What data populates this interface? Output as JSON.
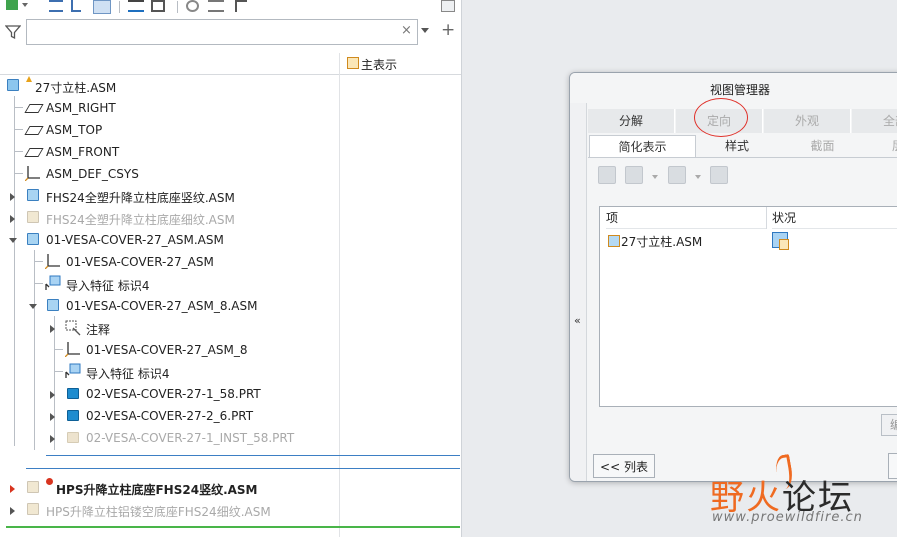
{
  "left_panel": {
    "search": {
      "value": "",
      "placeholder": ""
    },
    "clear_glyph": "×",
    "add_glyph": "+",
    "column_header": "主表示",
    "tree": [
      {
        "label": "27寸立柱.ASM",
        "icon": "assembly-icon"
      },
      {
        "label": "ASM_RIGHT",
        "icon": "datum-plane-icon"
      },
      {
        "label": "ASM_TOP",
        "icon": "datum-plane-icon"
      },
      {
        "label": "ASM_FRONT",
        "icon": "datum-plane-icon"
      },
      {
        "label": "ASM_DEF_CSYS",
        "icon": "csys-icon"
      },
      {
        "label": "FHS24全塑升降立柱底座竖纹.ASM",
        "icon": "assembly-icon"
      },
      {
        "label": "FHS24全塑升降立柱底座细纹.ASM",
        "icon": "assembly-icon",
        "state": "excluded"
      },
      {
        "label": "01-VESA-COVER-27_ASM.ASM",
        "icon": "assembly-icon"
      },
      {
        "label": "01-VESA-COVER-27_ASM",
        "icon": "csys-icon"
      },
      {
        "label": "导入特征 标识4",
        "icon": "import-feature-icon"
      },
      {
        "label": "01-VESA-COVER-27_ASM_8.ASM",
        "icon": "assembly-icon"
      },
      {
        "label": "注释",
        "icon": "annotation-icon"
      },
      {
        "label": "01-VESA-COVER-27_ASM_8",
        "icon": "csys-icon"
      },
      {
        "label": "导入特征 标识4",
        "icon": "import-feature-icon"
      },
      {
        "label": "02-VESA-COVER-27-1_58.PRT",
        "icon": "part-icon"
      },
      {
        "label": "02-VESA-COVER-27-2_6.PRT",
        "icon": "part-icon"
      },
      {
        "label": "02-VESA-COVER-27-1_INST_58.PRT",
        "icon": "part-icon",
        "state": "excluded"
      },
      {
        "label": "HPS升降立柱底座FHS24竖纹.ASM",
        "icon": "assembly-icon",
        "state": "error"
      },
      {
        "label": "HPS升降立柱铝镂空底座FHS24细纹.ASM",
        "icon": "assembly-icon",
        "state": "excluded"
      }
    ]
  },
  "dialog": {
    "title": "视图管理器",
    "collapse_glyph": "«",
    "tabs": [
      "分解",
      "定向",
      "外观",
      "全部"
    ],
    "subtabs": [
      "简化表示",
      "样式",
      "截面",
      "层"
    ],
    "list": {
      "columns": [
        "项",
        "状况"
      ],
      "rows": [
        {
          "item": "27寸立柱.ASM"
        }
      ]
    },
    "list_button": "<< 列表",
    "edit_button_partial": "编"
  },
  "watermark": {
    "title_a": "野火",
    "title_b": "论坛",
    "url": "www.proewildfire.cn"
  },
  "colors": {
    "accent": "#3d7fc4",
    "annotation": "#e0312a",
    "watermark": "#ef6a21"
  }
}
